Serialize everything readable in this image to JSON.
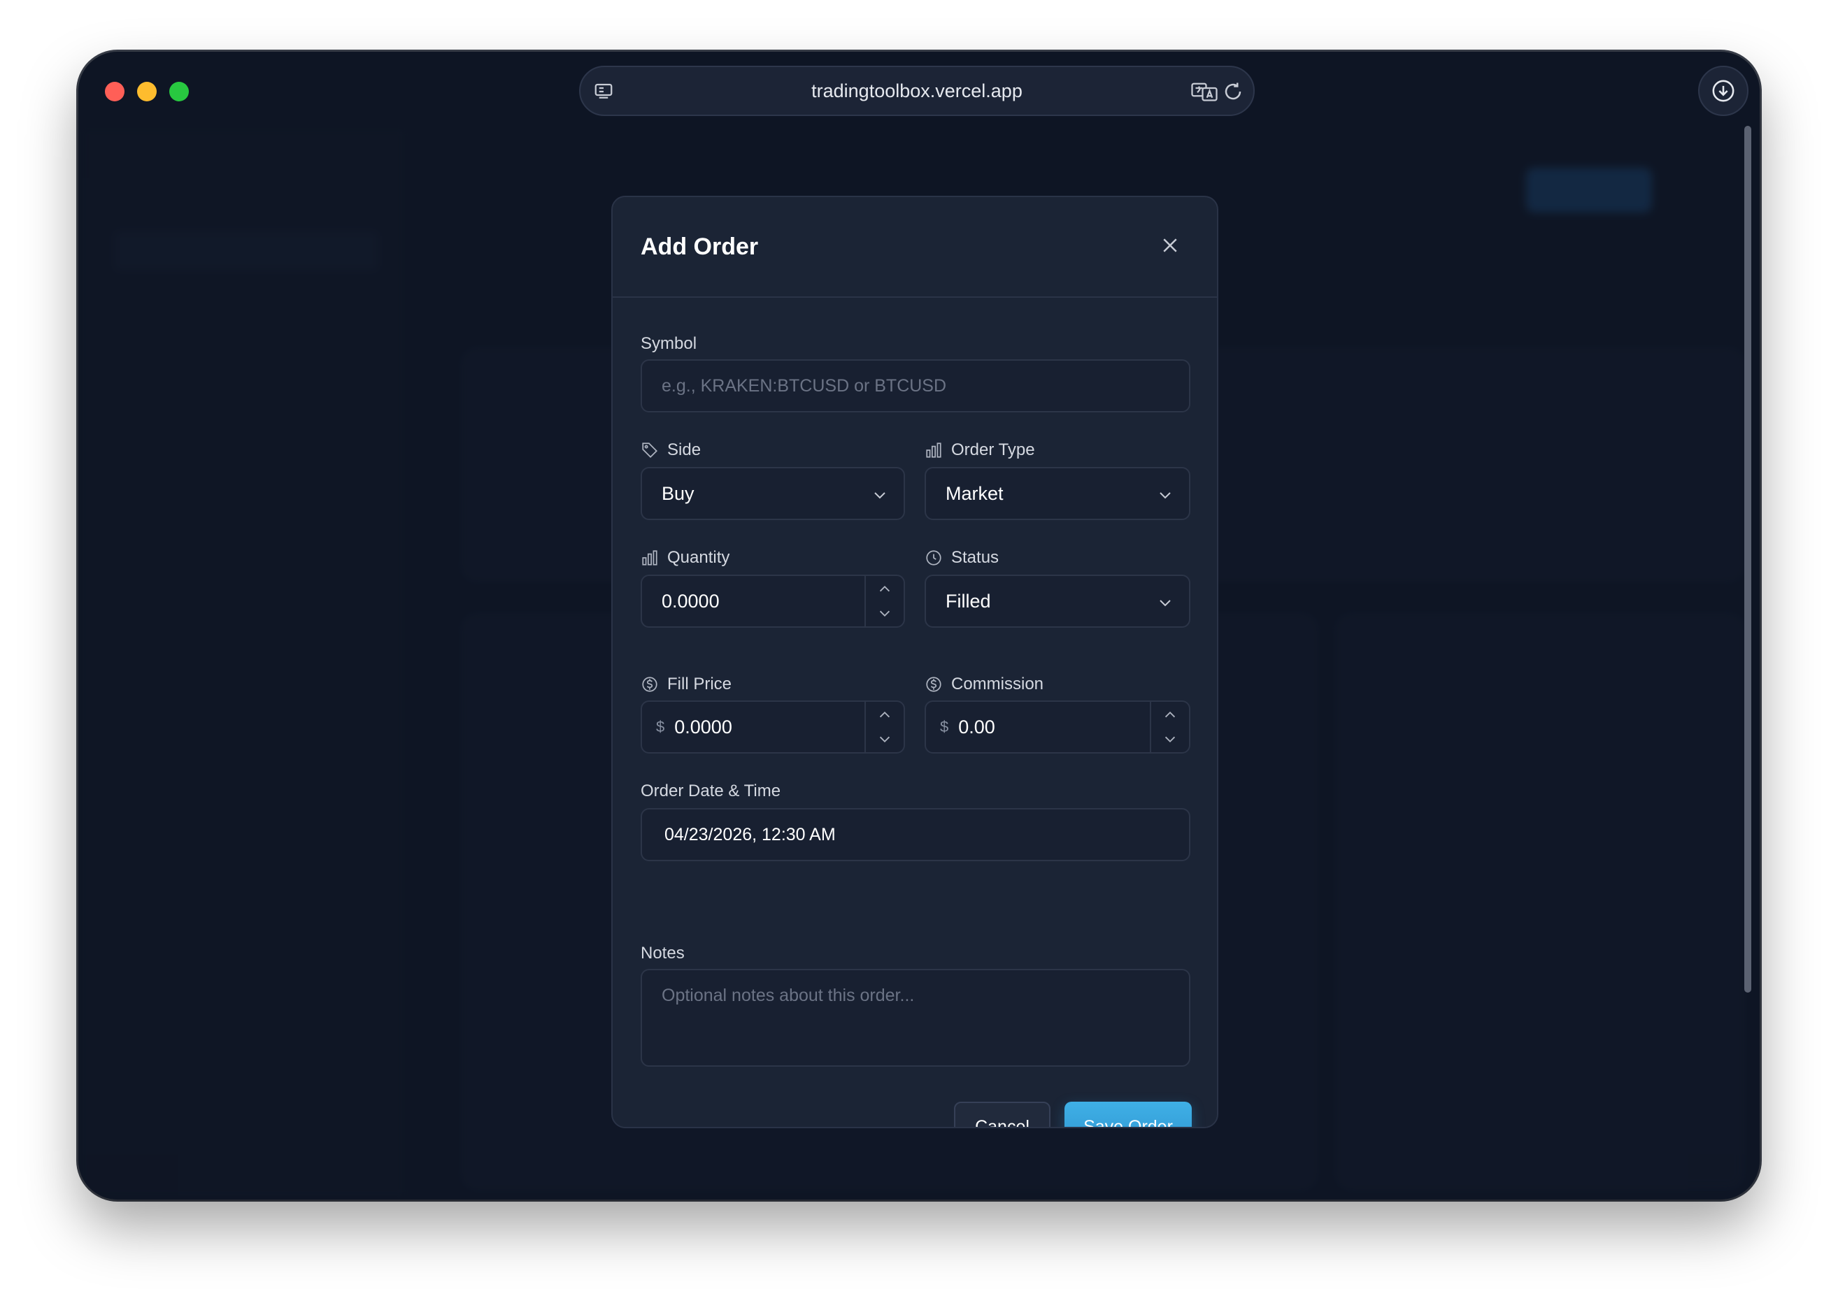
{
  "browser": {
    "url": "tradingtoolbox.vercel.app"
  },
  "modal": {
    "title": "Add Order",
    "symbol": {
      "label": "Symbol",
      "placeholder": "e.g., KRAKEN:BTCUSD or BTCUSD"
    },
    "side": {
      "label": "Side",
      "value": "Buy"
    },
    "order_type": {
      "label": "Order Type",
      "value": "Market"
    },
    "quantity": {
      "label": "Quantity",
      "value": "0.0000"
    },
    "status": {
      "label": "Status",
      "value": "Filled"
    },
    "fill_price": {
      "label": "Fill Price",
      "currency": "$",
      "value": "0.0000"
    },
    "commission": {
      "label": "Commission",
      "currency": "$",
      "value": "0.00"
    },
    "order_datetime": {
      "label": "Order Date & Time",
      "value": "04/23/2026, 12:30 AM"
    },
    "notes": {
      "label": "Notes",
      "placeholder": "Optional notes about this order..."
    },
    "cancel_label": "Cancel",
    "save_label": "Save Order"
  },
  "colors": {
    "accent": "#3fb0e6",
    "background": "#121a2c",
    "modal": "#1b2435"
  },
  "icons": [
    "sidebar-icon",
    "translate-icon",
    "reload-icon",
    "download-icon",
    "close-icon",
    "tag-icon",
    "bar-chart-icon",
    "clock-icon",
    "dollar-circle-icon",
    "chevron-down-icon",
    "chevron-up-icon"
  ]
}
